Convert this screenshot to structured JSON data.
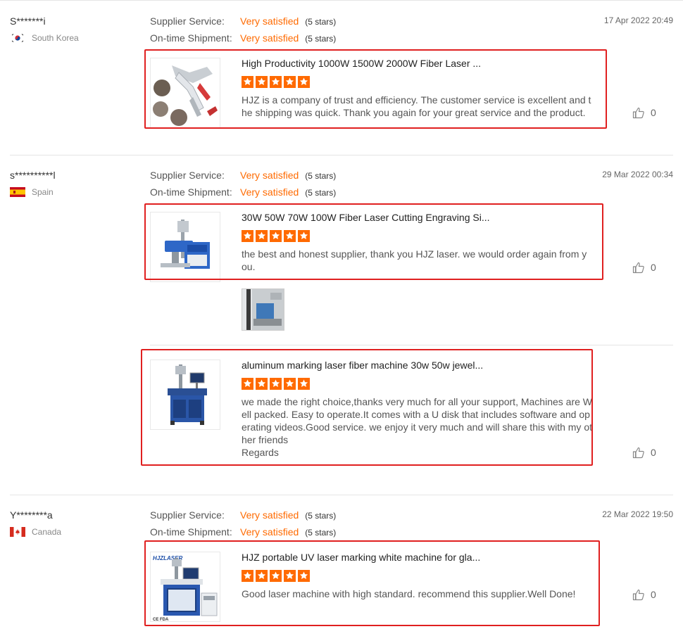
{
  "reviews": [
    {
      "buyer": "S*******i",
      "country": "South Korea",
      "supplier_service_label": "Supplier Service:",
      "supplier_service_value": "Very satisfied",
      "supplier_service_stars": "(5 stars)",
      "shipment_label": "On-time Shipment:",
      "shipment_value": "Very satisfied",
      "shipment_stars": "(5 stars)",
      "date": "17 Apr 2022 20:49",
      "items": [
        {
          "title": "High Productivity 1000W 1500W 2000W Fiber Laser ...",
          "rating": 5,
          "comment": "HJZ is a company of trust and efficiency. The customer service is excellent and the  shipping was quick. Thank you again for your great service and the product.",
          "likes": "0"
        }
      ]
    },
    {
      "buyer": "s**********l",
      "country": "Spain",
      "supplier_service_label": "Supplier Service:",
      "supplier_service_value": "Very satisfied",
      "supplier_service_stars": "(5 stars)",
      "shipment_label": "On-time Shipment:",
      "shipment_value": "Very satisfied",
      "shipment_stars": "(5 stars)",
      "date": "29 Mar 2022 00:34",
      "items": [
        {
          "title": "30W 50W 70W 100W Fiber Laser Cutting Engraving Si...",
          "rating": 5,
          "comment": "the best and honest supplier, thank you HJZ laser. we would order again from you.",
          "likes": "0"
        },
        {
          "title": "aluminum marking laser fiber machine 30w 50w jewel...",
          "rating": 5,
          "comment_lines": [
            "we made the right choice,thanks very much  for all your support, Machines are  Well packed. Easy to operate.It comes with a U disk that includes  software and operating videos.Good service. we enjoy it very much and will share this with my other friends",
            "Regards"
          ],
          "likes": "0"
        }
      ]
    },
    {
      "buyer": "Y********a",
      "country": "Canada",
      "supplier_service_label": "Supplier Service:",
      "supplier_service_value": "Very satisfied",
      "supplier_service_stars": "(5 stars)",
      "shipment_label": "On-time Shipment:",
      "shipment_value": "Very satisfied",
      "shipment_stars": "(5 stars)",
      "date": "22 Mar 2022 19:50",
      "items": [
        {
          "title": "HJZ portable UV laser marking white machine for gla...",
          "rating": 5,
          "comment": "Good laser machine with high standard. recommend this supplier.Well Done!",
          "likes": "0",
          "thumb_brand": "HJZLASER",
          "thumb_marks": "CE FDA"
        }
      ]
    }
  ],
  "colors": {
    "accent": "#ff6a00",
    "highlight": "#e02020"
  },
  "icons": {
    "like": "thumbs-up-icon",
    "star": "star-icon"
  }
}
